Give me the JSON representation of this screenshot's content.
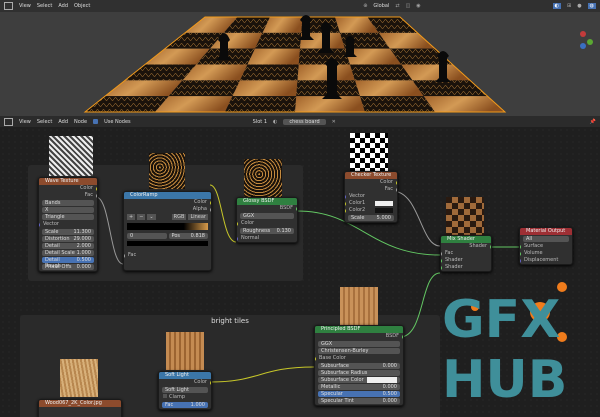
{
  "viewport_header": {
    "menus": [
      "View",
      "Select",
      "Add",
      "Object"
    ],
    "orientation": "Global"
  },
  "node_header": {
    "menus": [
      "View",
      "Select",
      "Add",
      "Node"
    ],
    "use_nodes": "Use Nodes",
    "slot": "Slot 1",
    "material": "chess board"
  },
  "frames": {
    "bright_tiles": "bright tiles"
  },
  "nodes": {
    "wave": {
      "title": "Wave Texture",
      "outputs": [
        "Color",
        "Fac"
      ],
      "opt1": "Bands",
      "opt2": "X",
      "opt3": "Triangle",
      "vector": "Vector",
      "params": [
        {
          "label": "Scale",
          "value": "11.300"
        },
        {
          "label": "Distortion",
          "value": "29.000"
        },
        {
          "label": "Detail",
          "value": "2.000"
        },
        {
          "label": "Detail Scale",
          "value": "1.000"
        },
        {
          "label": "Detail Rough",
          "value": "0.500"
        },
        {
          "label": "Phase Offs",
          "value": "0.000"
        }
      ]
    },
    "ramp": {
      "title": "ColorRamp",
      "outputs": [
        "Color",
        "Alpha"
      ],
      "mode": "RGB",
      "interp": "Linear",
      "index": "0",
      "pos_label": "Pos",
      "pos": "0.818",
      "fac": "Fac"
    },
    "glossy": {
      "title": "Glossy BSDF",
      "output": "BSDF",
      "dist": "GGX",
      "color": "Color",
      "roughness_label": "Roughness",
      "roughness": "0.130",
      "normal": "Normal"
    },
    "checker": {
      "title": "Checker Texture",
      "outputs": [
        "Color",
        "Fac"
      ],
      "inputs": [
        "Vector",
        "Color1",
        "Color2"
      ],
      "scale_label": "Scale",
      "scale": "5.000"
    },
    "mix": {
      "title": "Mix Shader",
      "output": "Shader",
      "inputs": [
        "Fac",
        "Shader",
        "Shader"
      ]
    },
    "output": {
      "title": "Material Output",
      "target": "All",
      "inputs": [
        "Surface",
        "Volume",
        "Displacement"
      ]
    },
    "principled": {
      "title": "Principled BSDF",
      "output": "BSDF",
      "dist": "GGX",
      "sss": "Christensen-Burley",
      "base_color": "Base Color",
      "rows": [
        {
          "label": "Subsurface",
          "value": "0.000"
        },
        {
          "label": "Subsurface Radius",
          "value": ""
        },
        {
          "label": "Subsurface Color",
          "value": ""
        },
        {
          "label": "Metallic",
          "value": "0.000"
        },
        {
          "label": "Specular",
          "value": "0.500"
        },
        {
          "label": "Specular Tint",
          "value": "0.000"
        }
      ]
    },
    "softlight": {
      "title": "Soft Light",
      "output": "Color",
      "mode": "Soft Light",
      "clamp": "Clamp",
      "fac_label": "Fac",
      "fac": "1.000"
    },
    "woodimg": {
      "title": "Wood067_2K_Color.jpg"
    }
  },
  "watermark": {
    "line1": "GFX",
    "line2": "HUB"
  },
  "colors": {
    "texture_header": "#8c4b2d",
    "shader_header": "#2f8040",
    "input_header": "#3b76a8",
    "output_header": "#9e2f34",
    "watermark_teal": "#3f8f9a",
    "watermark_orange": "#f07c1c"
  }
}
